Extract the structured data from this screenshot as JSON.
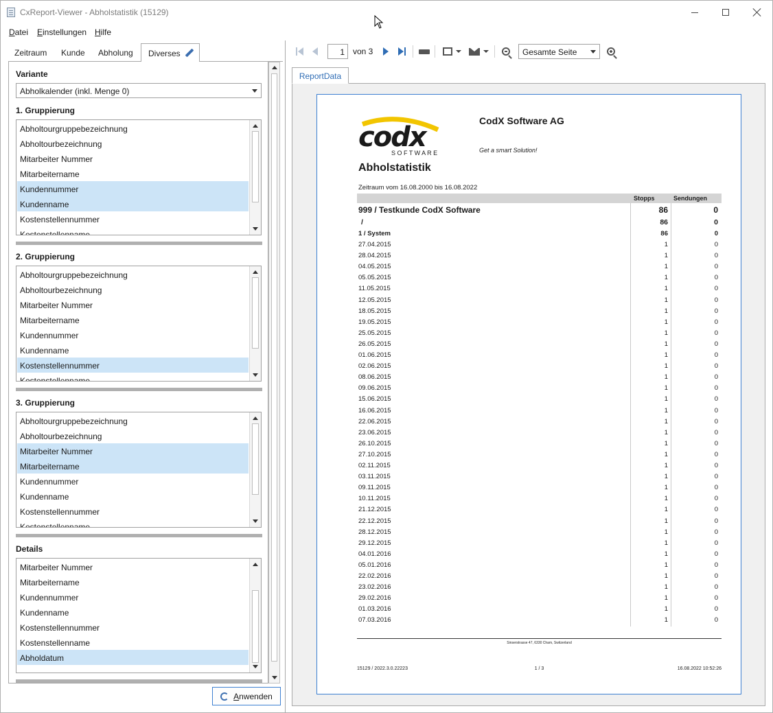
{
  "window": {
    "title": "CxReport-Viewer - Abholstatistik (15129)"
  },
  "menu": {
    "items": [
      {
        "pre": "",
        "u": "D",
        "post": "atei"
      },
      {
        "pre": "",
        "u": "E",
        "post": "instellungen"
      },
      {
        "pre": "",
        "u": "H",
        "post": "ilfe"
      }
    ]
  },
  "tabs": [
    "Zeitraum",
    "Kunde",
    "Abholung",
    "Diverses"
  ],
  "settings": {
    "variante_label": "Variante",
    "variante_value": "Abholkalender (inkl. Menge 0)",
    "group1_label": "1. Gruppierung",
    "group2_label": "2. Gruppierung",
    "group3_label": "3. Gruppierung",
    "details_label": "Details",
    "group1_items": [
      "Abholtourgruppebezeichnung",
      "Abholtourbezeichnung",
      "Mitarbeiter Nummer",
      "Mitarbeitername",
      "Kundennummer",
      "Kundenname",
      "Kostenstellennummer",
      "Kostenstellenname"
    ],
    "group1_selected": [
      4,
      5
    ],
    "group2_items": [
      "Abholtourgruppebezeichnung",
      "Abholtourbezeichnung",
      "Mitarbeiter Nummer",
      "Mitarbeitername",
      "Kundennummer",
      "Kundenname",
      "Kostenstellennummer",
      "Kostenstellenname"
    ],
    "group2_selected": [
      6
    ],
    "group3_items": [
      "Abholtourgruppebezeichnung",
      "Abholtourbezeichnung",
      "Mitarbeiter Nummer",
      "Mitarbeitername",
      "Kundennummer",
      "Kundenname",
      "Kostenstellennummer",
      "Kostenstellenname"
    ],
    "group3_selected": [
      2,
      3
    ],
    "details_items": [
      "Mitarbeiter Nummer",
      "Mitarbeitername",
      "Kundennummer",
      "Kundenname",
      "Kostenstellennummer",
      "Kostenstellenname",
      "Abholdatum"
    ],
    "details_selected": [
      6
    ],
    "apply_pre": "",
    "apply_u": "A",
    "apply_post": "nwenden"
  },
  "toolbar": {
    "page_value": "1",
    "of_text": "von  3",
    "zoom_value": "Gesamte Seite"
  },
  "report_tab": "ReportData",
  "report": {
    "company": "CodX Software AG",
    "slogan": "Get a smart Solution!",
    "logo_text": "codx",
    "logo_sub": "S O F T W A R E",
    "title": "Abholstatistik",
    "period": "Zeitraum vom 16.08.2000 bis 16.08.2022",
    "col_stopps": "Stopps",
    "col_sendungen": "Sendungen",
    "group_row": {
      "label": "999 / Testkunde CodX Software",
      "stopps": "86",
      "sendungen": "0"
    },
    "sub_row": {
      "label": "/",
      "stopps": "86",
      "sendungen": "0"
    },
    "sub2_row": {
      "label": "1 /  System",
      "stopps": "86",
      "sendungen": "0"
    },
    "rows": [
      [
        "27.04.2015",
        "1",
        "0"
      ],
      [
        "28.04.2015",
        "1",
        "0"
      ],
      [
        "04.05.2015",
        "1",
        "0"
      ],
      [
        "05.05.2015",
        "1",
        "0"
      ],
      [
        "11.05.2015",
        "1",
        "0"
      ],
      [
        "12.05.2015",
        "1",
        "0"
      ],
      [
        "18.05.2015",
        "1",
        "0"
      ],
      [
        "19.05.2015",
        "1",
        "0"
      ],
      [
        "25.05.2015",
        "1",
        "0"
      ],
      [
        "26.05.2015",
        "1",
        "0"
      ],
      [
        "01.06.2015",
        "1",
        "0"
      ],
      [
        "02.06.2015",
        "1",
        "0"
      ],
      [
        "08.06.2015",
        "1",
        "0"
      ],
      [
        "09.06.2015",
        "1",
        "0"
      ],
      [
        "15.06.2015",
        "1",
        "0"
      ],
      [
        "16.06.2015",
        "1",
        "0"
      ],
      [
        "22.06.2015",
        "1",
        "0"
      ],
      [
        "23.06.2015",
        "1",
        "0"
      ],
      [
        "26.10.2015",
        "1",
        "0"
      ],
      [
        "27.10.2015",
        "1",
        "0"
      ],
      [
        "02.11.2015",
        "1",
        "0"
      ],
      [
        "03.11.2015",
        "1",
        "0"
      ],
      [
        "09.11.2015",
        "1",
        "0"
      ],
      [
        "10.11.2015",
        "1",
        "0"
      ],
      [
        "21.12.2015",
        "1",
        "0"
      ],
      [
        "22.12.2015",
        "1",
        "0"
      ],
      [
        "28.12.2015",
        "1",
        "0"
      ],
      [
        "29.12.2015",
        "1",
        "0"
      ],
      [
        "04.01.2016",
        "1",
        "0"
      ],
      [
        "05.01.2016",
        "1",
        "0"
      ],
      [
        "22.02.2016",
        "1",
        "0"
      ],
      [
        "23.02.2016",
        "1",
        "0"
      ],
      [
        "29.02.2016",
        "1",
        "0"
      ],
      [
        "01.03.2016",
        "1",
        "0"
      ],
      [
        "07.03.2016",
        "1",
        "0"
      ]
    ],
    "address": "Sinserstrasse 47,  6330 Cham,  Switzerland",
    "footer_left": "15129 / 2022.3.0.22223",
    "footer_center": "1 / 3",
    "footer_right": "16.08.2022 10:52:26"
  },
  "colors": {
    "accent": "#2f6db5",
    "selection": "#cce4f7",
    "logo_yellow": "#f2c500"
  }
}
